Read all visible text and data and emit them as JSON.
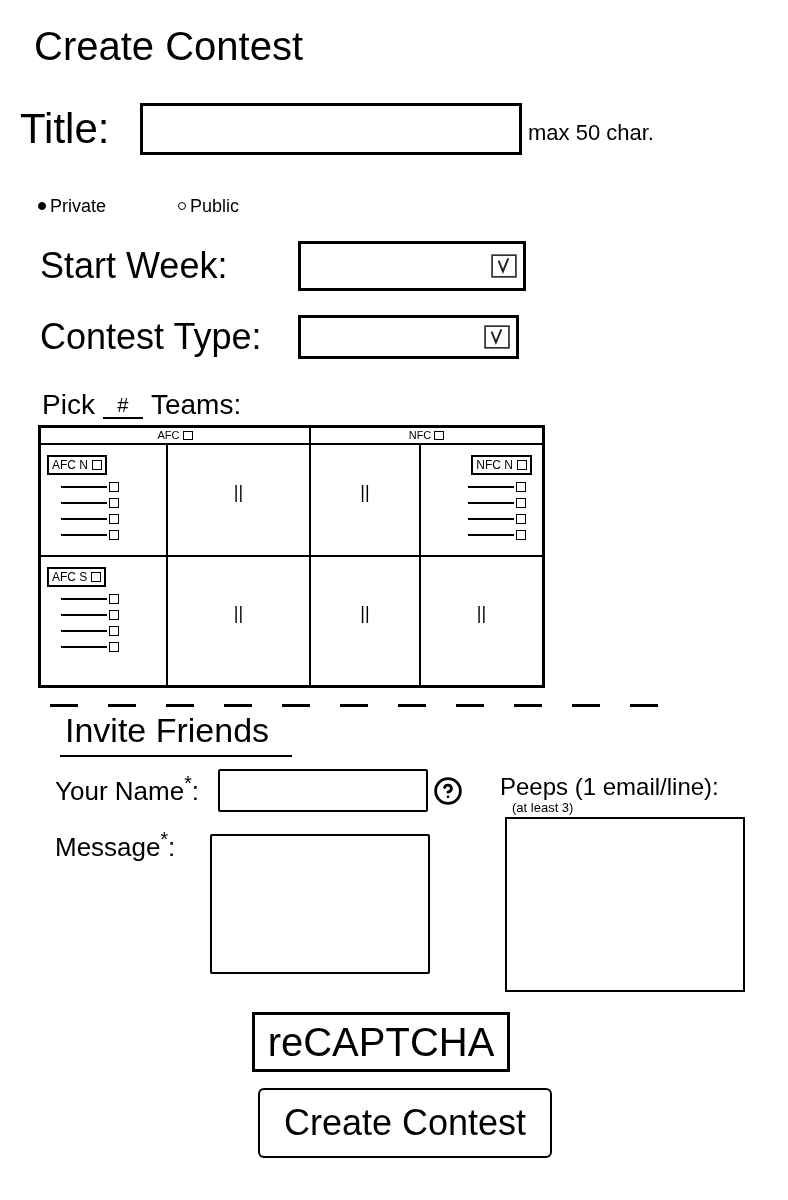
{
  "heading": "Create Contest",
  "title_field": {
    "label": "Title:",
    "note": "max 50 char."
  },
  "visibility": [
    {
      "label": "Private",
      "selected": true
    },
    {
      "label": "Public",
      "selected": false
    }
  ],
  "selects": [
    {
      "label": "Start Week:"
    },
    {
      "label": "Contest Type:"
    }
  ],
  "teams": {
    "label_before": "Pick",
    "count": {
      "placeholder": "#"
    },
    "label_after": "Teams:",
    "header": [
      {
        "label": "AFC",
        "checked": false
      },
      {
        "label": "NFC",
        "checked": false
      }
    ],
    "rows": [
      {
        "cells": [
          {
            "kind": "division",
            "label": "AFC N",
            "checked": false,
            "teams": [
              {
                "checked": false
              },
              {
                "checked": false
              },
              {
                "checked": false
              },
              {
                "checked": false
              }
            ]
          },
          {
            "kind": "ditto",
            "text": "||"
          },
          {
            "kind": "ditto",
            "text": "||"
          },
          {
            "kind": "division",
            "label": "NFC N",
            "checked": false,
            "teams": [
              {
                "checked": false
              },
              {
                "checked": false
              },
              {
                "checked": false
              },
              {
                "checked": false
              }
            ]
          }
        ]
      },
      {
        "cells": [
          {
            "kind": "division",
            "label": "AFC S",
            "checked": false,
            "teams": [
              {
                "checked": false
              },
              {
                "checked": false
              },
              {
                "checked": false
              },
              {
                "checked": false
              }
            ]
          },
          {
            "kind": "ditto",
            "text": "||"
          },
          {
            "kind": "ditto",
            "text": "||"
          },
          {
            "kind": "ditto",
            "text": "||"
          }
        ]
      }
    ]
  },
  "invite": {
    "heading": "Invite Friends",
    "name_label": "Your Name$^{*}$:",
    "message_label": "Message$^{*}$:",
    "peeps_label": "Peeps (1 email/line):",
    "peeps_note": "(at least 3)"
  },
  "captcha": {
    "text": "reCAPTCHA"
  },
  "submit": {
    "label": "Create Contest"
  }
}
